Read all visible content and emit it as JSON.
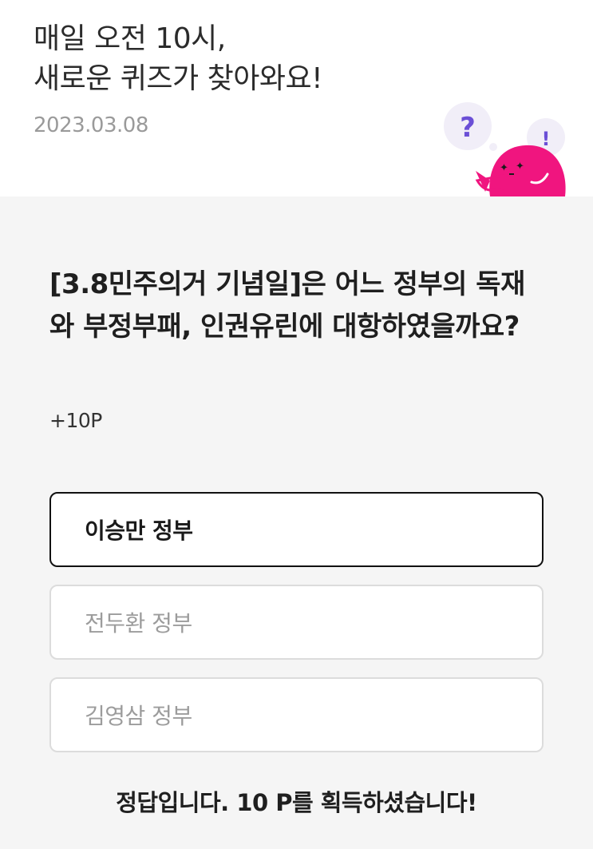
{
  "header": {
    "title_line1": "매일 오전 10시,",
    "title_line2": "새로운 퀴즈가 찾아와요!",
    "date": "2023.03.08",
    "mascot": {
      "bubble_left_glyph": "?",
      "bubble_right_glyph": "!",
      "body_color": "#f0157f",
      "question_mark_color": "#6b4fd6"
    }
  },
  "quiz": {
    "question": "[3.8민주의거 기념일]은 어느 정부의 독재와 부정부패, 인권유린에 대항하였을까요?",
    "reward": "+10P",
    "options": [
      {
        "label": "이승만 정부",
        "selected": true
      },
      {
        "label": "전두환 정부",
        "selected": false
      },
      {
        "label": "김영삼 정부",
        "selected": false
      }
    ],
    "result_message": "정답입니다. 10 P를 획득하셨습니다!"
  }
}
